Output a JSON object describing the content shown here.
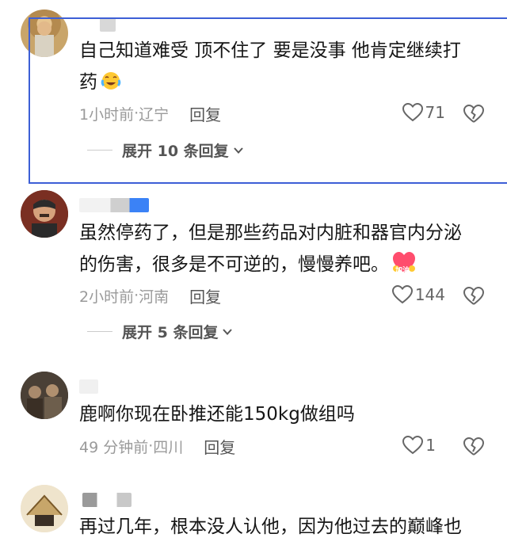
{
  "comments": [
    {
      "text_line1": "自己知道难受 顶不住了 要是没事 他肯定继续打",
      "text_line2": "药",
      "emoji": "crying-laughing-emoji",
      "time": "1小时前",
      "location": "辽宁",
      "reply_label": "回复",
      "likes": "71",
      "expand_label": "展开 10 条回复"
    },
    {
      "text_line1": "虽然停药了，但是那些药品对内脏和器官内分泌",
      "text_line2": "的伤害，很多是不可逆的，慢慢养吧。",
      "emoji": "jiayou-emoji",
      "emoji_text": "加油",
      "time": "2小时前",
      "location": "河南",
      "reply_label": "回复",
      "likes": "144",
      "expand_label": "展开 5 条回复"
    },
    {
      "text_line1": "鹿啊你现在卧推还能150kg做组吗",
      "time": "49 分钟前",
      "location": "四川",
      "reply_label": "回复",
      "likes": "1"
    },
    {
      "text_line1": "再过几年，根本没人认他，因为他过去的巅峰也"
    }
  ],
  "meta_separator": " · ",
  "colors": {
    "highlight_border": "#3d5fd6",
    "meta_gray": "#9a9a9a"
  }
}
